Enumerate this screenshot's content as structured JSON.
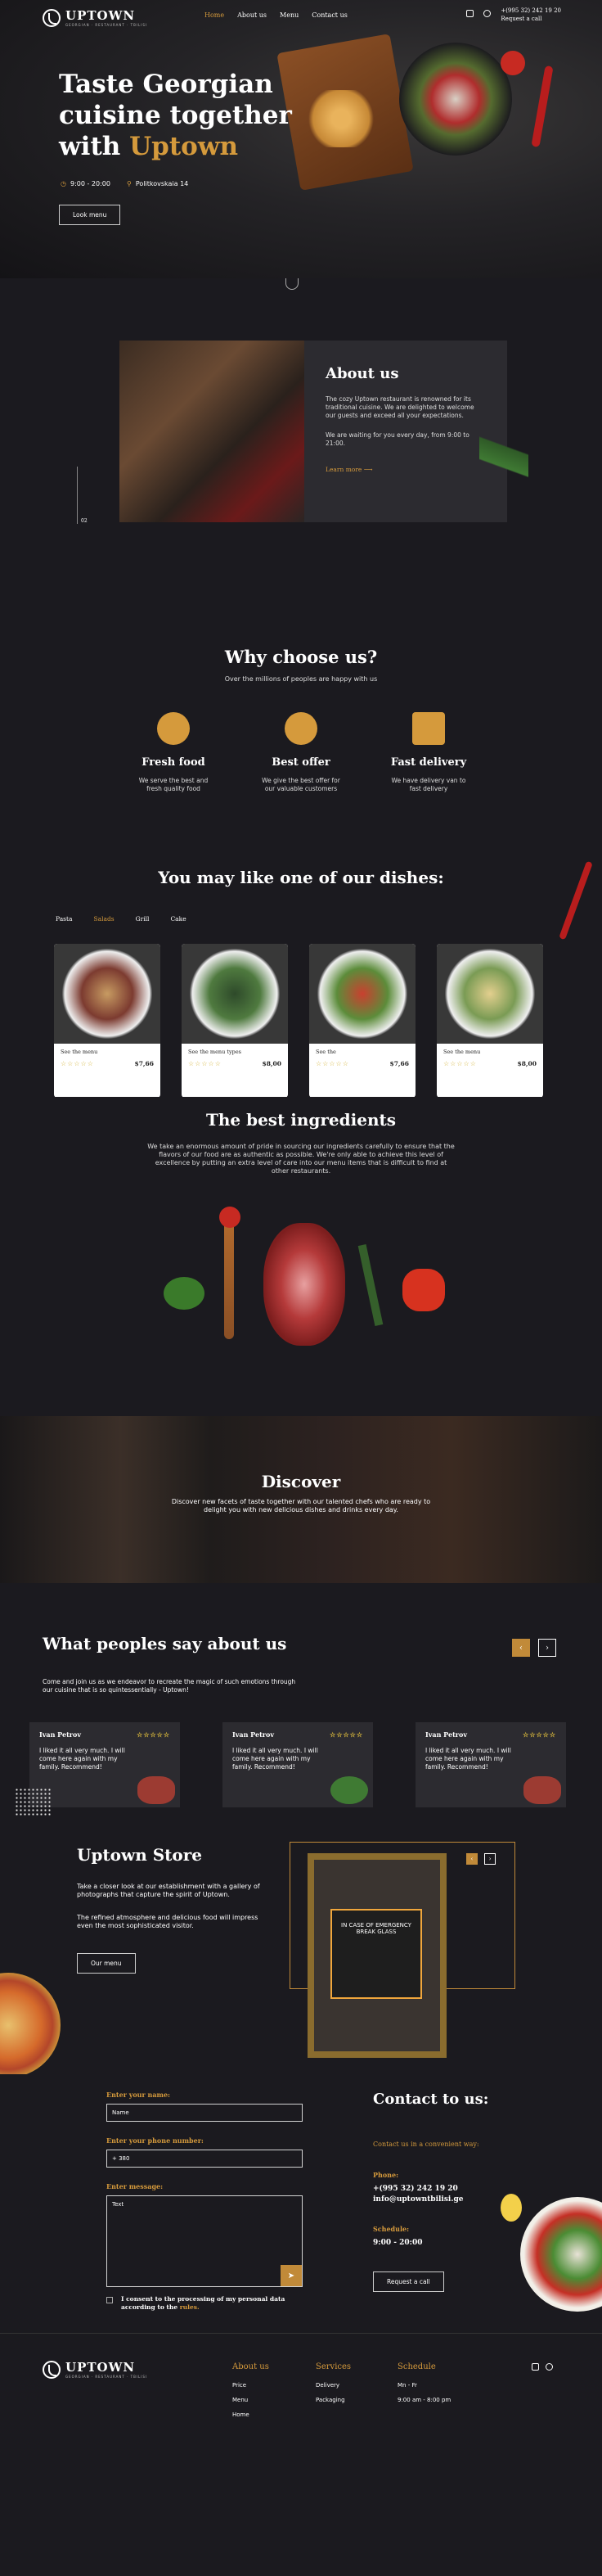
{
  "brand": {
    "name": "UPTOWN",
    "tagline": "GEORGIAN · RESTAURANT · TBILISI"
  },
  "nav": {
    "items": [
      "Home",
      "About us",
      "Menu",
      "Contact us"
    ],
    "active": "Home"
  },
  "header": {
    "phone": "+(995 32) 242 19 20",
    "call": "Request a call",
    "social_icons": [
      "facebook-icon",
      "instagram-icon"
    ]
  },
  "hero": {
    "title_1": "Taste Georgian",
    "title_2": "cuisine together",
    "title_3": "with ",
    "title_brand": "Uptown",
    "hours": "9:00 - 20:00",
    "address": "Politkovskaia 14",
    "button": "Look menu"
  },
  "about": {
    "title": "About us",
    "p1": "The cozy Uptown restaurant is renowned for its traditional cuisine. We are delighted to welcome our guests and exceed all your expectations.",
    "p2": "We are waiting for you every day, from 9:00 to 21:00.",
    "more": "Learn more",
    "counter": "02"
  },
  "why": {
    "title": "Why choose us?",
    "subtitle": "Over the millions of peoples are happy with us",
    "items": [
      {
        "icon": "fresh-food-icon",
        "title": "Fresh food",
        "text": "We serve the best and fresh quality food"
      },
      {
        "icon": "percent-badge-icon",
        "title": "Best offer",
        "text": "We give the best offer for our valuable customers"
      },
      {
        "icon": "delivery-truck-icon",
        "title": "Fast delivery",
        "text": "We have delivery van to fast delivery"
      }
    ]
  },
  "dishes": {
    "title": "You may like one of our dishes:",
    "tabs": [
      "Pasta",
      "Salads",
      "Grill",
      "Cake"
    ],
    "active_tab": "Salads",
    "cards": [
      {
        "title": "See the menu",
        "price": "$7,66",
        "stars": "☆☆☆☆☆"
      },
      {
        "title": "See the menu types",
        "price": "$8,00",
        "stars": "☆☆☆☆☆"
      },
      {
        "title": "See the",
        "price": "$7,66",
        "stars": "☆☆☆☆☆"
      },
      {
        "title": "See the menu",
        "price": "$8,00",
        "stars": "☆☆☆☆☆"
      }
    ]
  },
  "ingredients": {
    "title": "The best ingredients",
    "text": "We take an enormous amount of pride in sourcing our ingredients carefully to ensure that the flavors of our food are as authentic as possible. We're only able to achieve this level of excellence by putting an extra level of care into our menu items that is difficult to find at other restaurants."
  },
  "discover": {
    "title": "Discover",
    "text": "Discover new facets of taste together with our talented chefs who are ready to delight you with new delicious dishes and drinks every day."
  },
  "reviews": {
    "title": "What peoples say about us",
    "intro": "Come and join us as we endeavor to recreate the magic of such emotions through our cuisine that is so quintessentially - Uptown!",
    "prev": "‹",
    "next": "›",
    "items": [
      {
        "name": "Ivan Petrov",
        "stars": "☆☆☆☆☆",
        "text": "I liked it all very much. I will come here again with my family. Recommend!"
      },
      {
        "name": "Ivan Petrov",
        "stars": "☆☆☆☆☆",
        "text": "I liked it all very much. I will come here again with my family. Recommend!"
      },
      {
        "name": "Ivan Petrov",
        "stars": "☆☆☆☆☆",
        "text": "I liked it all very much. I will come here again with my family. Recommend!"
      }
    ]
  },
  "store": {
    "title": "Uptown Store",
    "p1": "Take a closer look at our establishment with a gallery of photographs that capture the spirit of Uptown.",
    "p2": "The refined atmosphere and delicious food will impress even the most sophisticated visitor.",
    "button": "Our menu",
    "sign": "IN CASE OF EMERGENCY BREAK GLASS"
  },
  "form": {
    "name_label": "Enter your name:",
    "name_placeholder": "Name",
    "phone_label": "Enter your phone number:",
    "phone_value": "+ 380",
    "message_label": "Enter message:",
    "message_placeholder": "Text",
    "consent": "I consent to the processing of my personal data according to the ",
    "consent_link": "rules."
  },
  "contact": {
    "title": "Contact to us:",
    "how": "Contact us in a convenient way:",
    "phone_label": "Phone:",
    "phone": "+(995 32) 242 19 20",
    "email": "info@uptowntbilisi.ge",
    "schedule_label": "Schedule:",
    "schedule": "9:00 - 20:00",
    "button": "Request a call"
  },
  "footer": {
    "col1": {
      "title": "About us",
      "items": [
        "Price",
        "Menu",
        "Home"
      ]
    },
    "col2": {
      "title": "Services",
      "items": [
        "Delivery",
        "Packaging"
      ]
    },
    "col3": {
      "title": "Schedule",
      "items": [
        "Mn - Fr",
        "9:00 am - 8:00 pm"
      ]
    }
  },
  "colors": {
    "accent": "#d59a3c",
    "bg": "#1b1a1f",
    "card": "#2c2b30"
  }
}
